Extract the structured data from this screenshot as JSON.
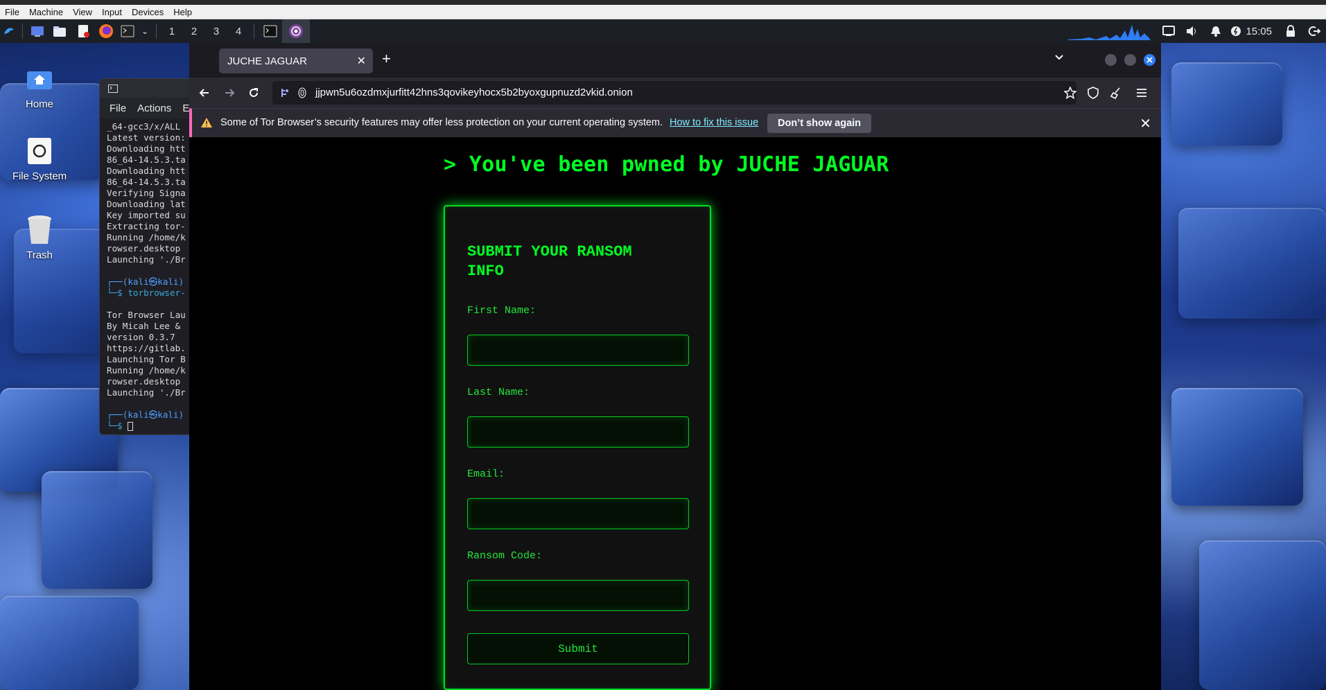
{
  "vm": {
    "menus": [
      "File",
      "Machine",
      "View",
      "Input",
      "Devices",
      "Help"
    ]
  },
  "panel": {
    "workspaces": [
      "1",
      "2",
      "3",
      "4"
    ],
    "clock": "15:05",
    "launcher_icons": [
      "kali-menu-icon",
      "desktop-icon",
      "file-manager-icon",
      "text-editor-icon",
      "firefox-icon",
      "terminal-icon"
    ]
  },
  "desktop": {
    "icons": [
      {
        "label": "Home",
        "icon": "home-icon"
      },
      {
        "label": "File System",
        "icon": "drive-icon"
      },
      {
        "label": "Trash",
        "icon": "trash-icon"
      }
    ]
  },
  "terminal": {
    "menus": [
      "File",
      "Actions",
      "Ed"
    ],
    "lines": [
      "_64-gcc3/x/ALL",
      "Latest version:",
      "Downloading htt",
      "86_64-14.5.3.ta",
      "Downloading htt",
      "86_64-14.5.3.ta",
      "Verifying Signa",
      "Downloading lat",
      "Key imported su",
      "Extracting tor-",
      "Running /home/k",
      "rowser.desktop",
      "Launching './Br",
      "",
      "┌──(kali㉿kali)",
      "└─$ torbrowser-",
      "",
      "Tor Browser Lau",
      "By Micah Lee &",
      "version 0.3.7",
      "https://gitlab.",
      "Launching Tor B",
      "Running /home/k",
      "rowser.desktop",
      "Launching './Br",
      "",
      "┌──(kali㉿kali)",
      "└─$ "
    ]
  },
  "browser": {
    "tab_title": "JUCHE JAGUAR",
    "url": "jjpwn5u6ozdmxjurfitt42hns3qovikeyhocx5b2byoxgupnuzd2vkid.onion",
    "notification": {
      "text": "Some of Tor Browser’s security features may offer less protection on your current operating system.",
      "link": "How to fix this issue",
      "button": "Don’t show again"
    }
  },
  "page": {
    "headline": "> You've been pwned by JUCHE JAGUAR",
    "form": {
      "heading": "SUBMIT YOUR RANSOM INFO",
      "fields": [
        {
          "label": "First Name:",
          "value": ""
        },
        {
          "label": "Last Name:",
          "value": ""
        },
        {
          "label": "Email:",
          "value": ""
        },
        {
          "label": "Ransom Code:",
          "value": ""
        }
      ],
      "submit": "Submit"
    }
  },
  "colors": {
    "accent_green": "#00ff22",
    "browser_chrome": "#2b2a33",
    "tab_active": "#42414d",
    "notif_stripe": "#ff6bb8"
  }
}
